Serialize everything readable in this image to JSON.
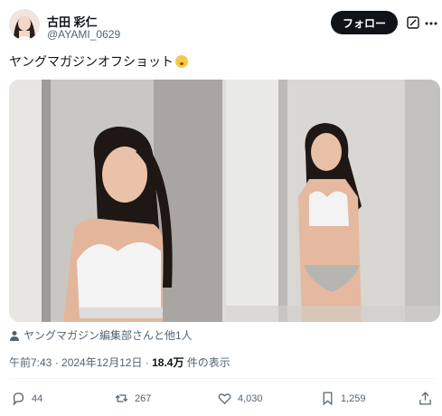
{
  "author": {
    "display_name": "古田 彩仁",
    "handle": "@AYAMI_0629"
  },
  "header": {
    "follow_label": "フォロー"
  },
  "tweet": {
    "text": "ヤングマガジンオフショット",
    "emoji": "shushing-face-emoji"
  },
  "media": {
    "left_photo": "photo of woman in white sports bra leaning against wall",
    "right_photo": "photo of woman in white sports bra and grey bikini standing by curtain"
  },
  "tagged": {
    "text": "ヤングマガジン編集部さんと他1人"
  },
  "meta": {
    "time": "午前7:43",
    "sep1": " · ",
    "date": "2024年12月12日",
    "sep2": " · ",
    "views_count": "18.4万",
    "views_label": " 件の表示"
  },
  "actions": {
    "replies": "44",
    "reposts": "267",
    "likes": "4,030",
    "bookmarks": "1,259"
  },
  "colors": {
    "text": "#0f1419",
    "secondary": "#536471",
    "follow_bg": "#0f1419"
  }
}
